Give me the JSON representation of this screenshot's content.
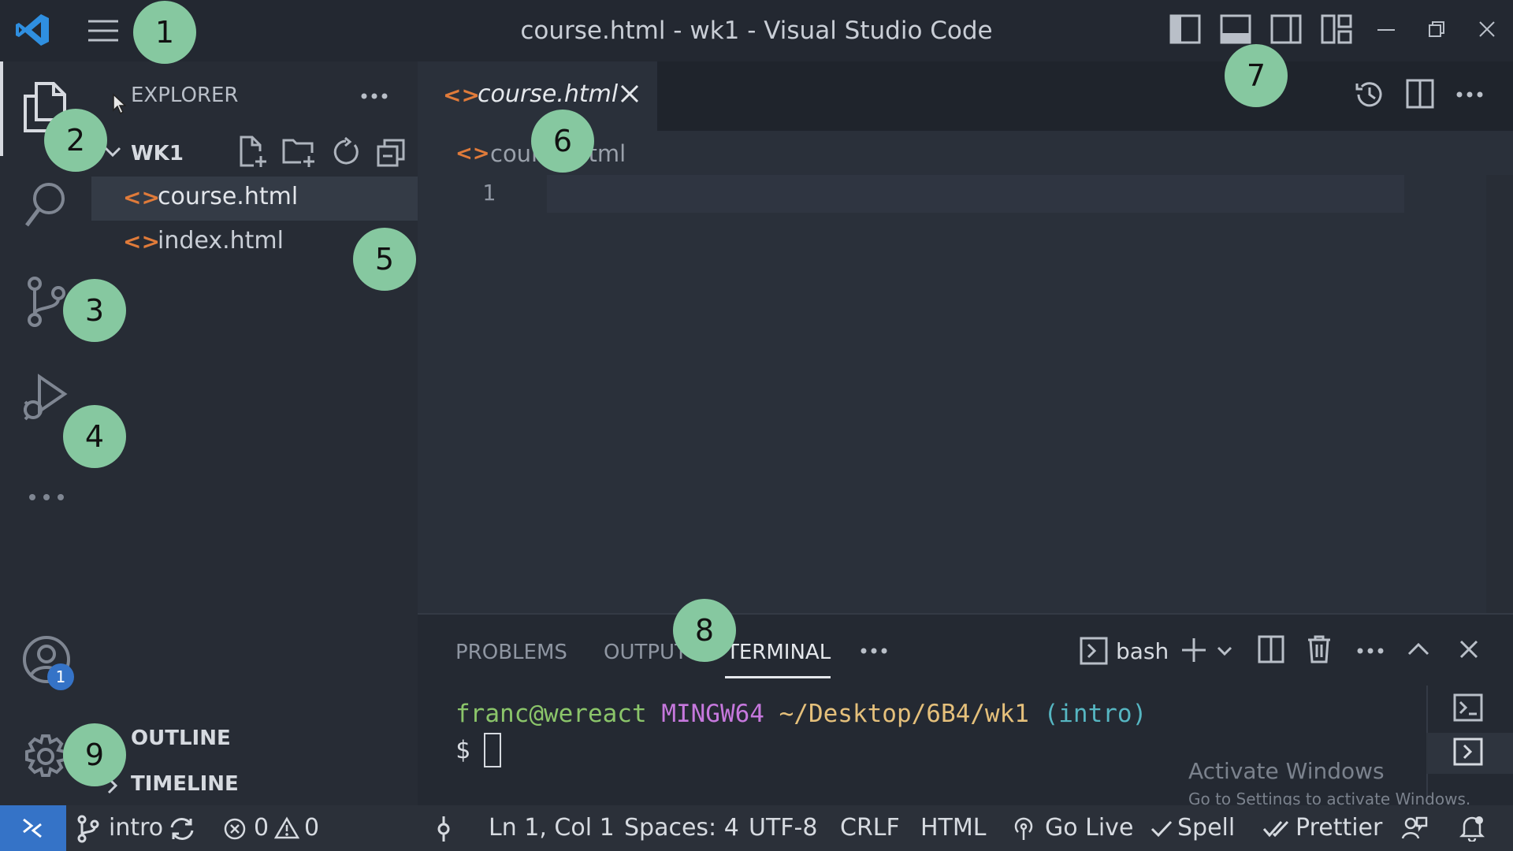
{
  "window": {
    "title": "course.html - wk1 - Visual Studio Code"
  },
  "explorer": {
    "header": "EXPLORER",
    "folder": "WK1",
    "files": [
      {
        "name": "course.html"
      },
      {
        "name": "index.html"
      }
    ],
    "outline": "OUTLINE",
    "timeline": "TIMELINE"
  },
  "editor": {
    "tab_label": "course.html",
    "breadcrumb": "course.html",
    "line_number": "1"
  },
  "panel": {
    "tabs": [
      "PROBLEMS",
      "OUTPUT",
      "TERMINAL"
    ],
    "active_tab": "TERMINAL",
    "shell": "bash",
    "prompt": {
      "user_host": "franc@wereact",
      "env": "MINGW64",
      "path": "~/Desktop/6B4/wk1",
      "branch": "(intro)",
      "symbol": "$"
    }
  },
  "watermark": {
    "title": "Activate Windows",
    "subtitle": "Go to Settings to activate Windows."
  },
  "accounts_badge": "1",
  "statusbar": {
    "branch": "intro",
    "errors": "0",
    "warnings": "0",
    "cursor": "Ln 1, Col 1",
    "spaces": "Spaces: 4",
    "encoding": "UTF-8",
    "eol": "CRLF",
    "language": "HTML",
    "golive": "Go Live",
    "spell": "Spell",
    "prettier": "Prettier"
  },
  "callouts": [
    "1",
    "2",
    "3",
    "4",
    "5",
    "6",
    "7",
    "8",
    "9"
  ],
  "colors": {
    "accent": "#3573c7",
    "callout": "#86c8a0",
    "html_icon": "#e07b3a",
    "terminal_user": "#8bc56a",
    "terminal_env": "#c678dd",
    "terminal_path": "#e5c07b",
    "terminal_branch": "#56b6c2"
  }
}
